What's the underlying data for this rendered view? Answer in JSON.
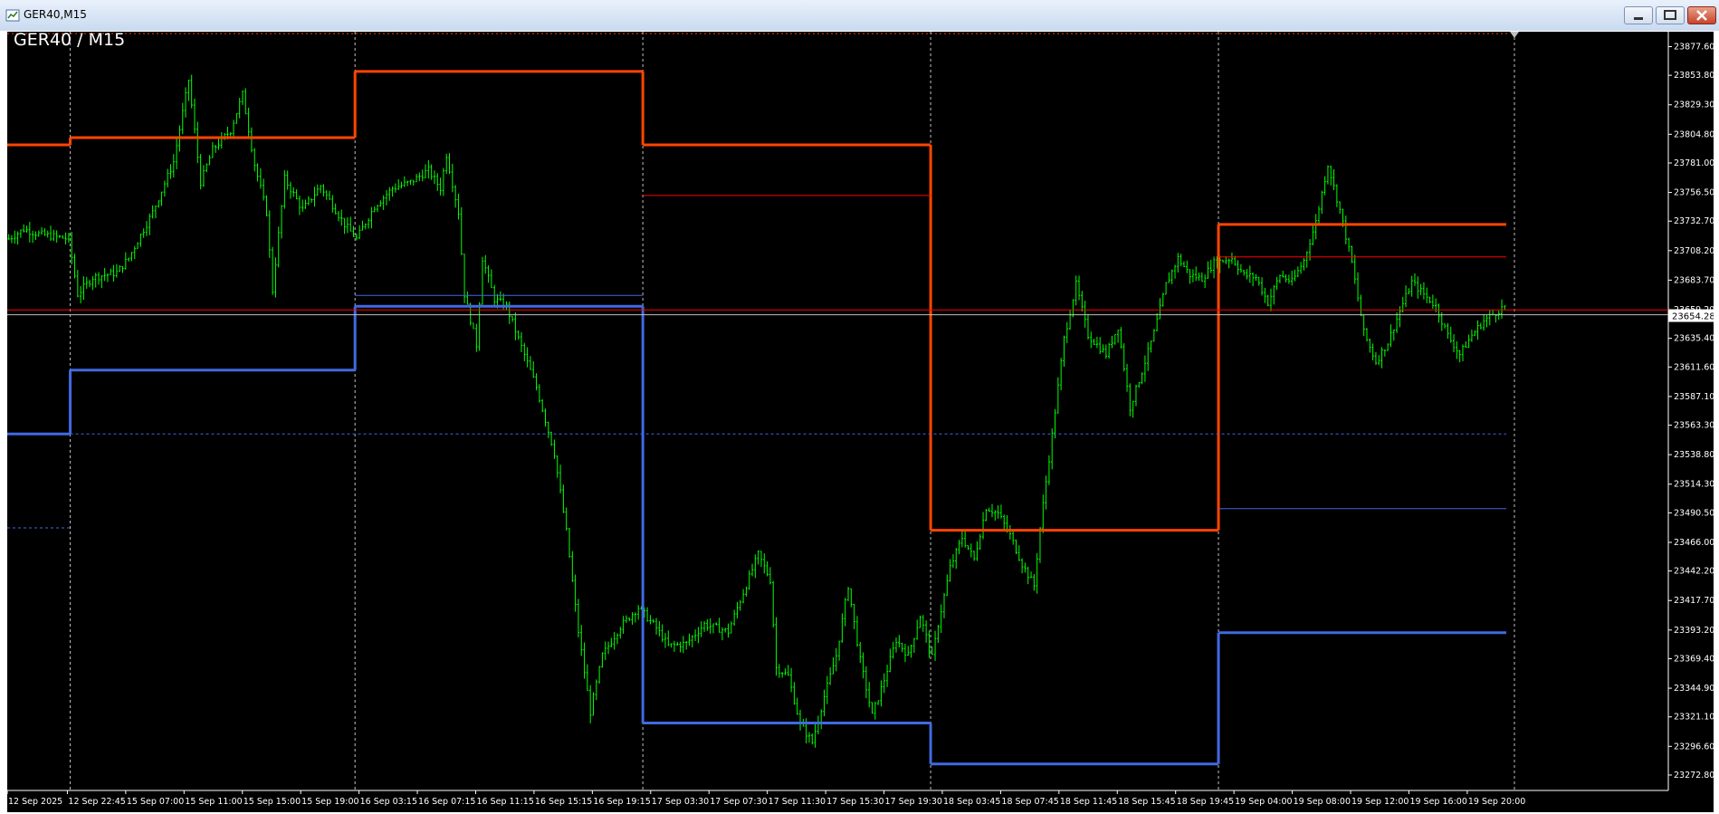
{
  "window": {
    "title": "GER40,M15"
  },
  "chart_label": "GER40 / M15",
  "colors": {
    "background": "#000000",
    "candles": "#00ff00",
    "orange_level": "#ff4500",
    "blue_level": "#4169e1",
    "red_line": "#ff0000",
    "grid_separator": "#c0c0c0",
    "price_tag_bg": "#ffffff"
  },
  "icons": {
    "minimize": "minimize-icon",
    "maximize": "maximize-icon",
    "close": "close-icon"
  },
  "chart_data": {
    "type": "candlestick",
    "symbol": "GER40",
    "timeframe": "M15",
    "current_price": "23654.28",
    "ylim": [
      23260,
      23890
    ],
    "y_ticks": [
      "23877.60",
      "23853.80",
      "23829.30",
      "23804.80",
      "23781.00",
      "23756.50",
      "23732.70",
      "23708.20",
      "23683.70",
      "23659.20",
      "23635.40",
      "23611.60",
      "23587.10",
      "23563.30",
      "23538.80",
      "23514.30",
      "23490.50",
      "23466.00",
      "23442.20",
      "23417.70",
      "23393.20",
      "23369.40",
      "23344.90",
      "23321.10",
      "23296.60",
      "23272.80"
    ],
    "x_ticks": [
      "12 Sep 2025",
      "12 Sep 22:45",
      "15 Sep 07:00",
      "15 Sep 11:00",
      "15 Sep 15:00",
      "15 Sep 19:00",
      "16 Sep 03:15",
      "16 Sep 07:15",
      "16 Sep 11:15",
      "16 Sep 15:15",
      "16 Sep 19:15",
      "17 Sep 03:30",
      "17 Sep 07:30",
      "17 Sep 11:30",
      "17 Sep 15:30",
      "17 Sep 19:30",
      "18 Sep 03:45",
      "18 Sep 07:45",
      "18 Sep 11:45",
      "18 Sep 15:45",
      "18 Sep 19:45",
      "19 Sep 04:00",
      "19 Sep 08:00",
      "19 Sep 12:00",
      "19 Sep 16:00",
      "19 Sep 20:00"
    ],
    "n_bars": 500,
    "day_separators_at_bar": [
      21,
      116,
      212,
      308,
      404
    ],
    "price_path": [
      [
        0,
        23718
      ],
      [
        5,
        23726
      ],
      [
        10,
        23722
      ],
      [
        20,
        23718
      ],
      [
        23,
        23672
      ],
      [
        28,
        23686
      ],
      [
        36,
        23690
      ],
      [
        40,
        23702
      ],
      [
        48,
        23740
      ],
      [
        55,
        23782
      ],
      [
        60,
        23850
      ],
      [
        64,
        23765
      ],
      [
        68,
        23792
      ],
      [
        74,
        23808
      ],
      [
        78,
        23838
      ],
      [
        82,
        23780
      ],
      [
        86,
        23740
      ],
      [
        88,
        23675
      ],
      [
        92,
        23768
      ],
      [
        98,
        23742
      ],
      [
        104,
        23762
      ],
      [
        112,
        23730
      ],
      [
        116,
        23718
      ],
      [
        122,
        23745
      ],
      [
        128,
        23760
      ],
      [
        134,
        23765
      ],
      [
        140,
        23775
      ],
      [
        144,
        23760
      ],
      [
        146,
        23788
      ],
      [
        150,
        23740
      ],
      [
        152,
        23672
      ],
      [
        156,
        23630
      ],
      [
        158,
        23702
      ],
      [
        162,
        23668
      ],
      [
        166,
        23662
      ],
      [
        170,
        23635
      ],
      [
        176,
        23595
      ],
      [
        182,
        23540
      ],
      [
        186,
        23475
      ],
      [
        190,
        23392
      ],
      [
        194,
        23325
      ],
      [
        198,
        23372
      ],
      [
        204,
        23396
      ],
      [
        210,
        23412
      ],
      [
        216,
        23395
      ],
      [
        220,
        23380
      ],
      [
        226,
        23382
      ],
      [
        232,
        23398
      ],
      [
        240,
        23392
      ],
      [
        244,
        23418
      ],
      [
        250,
        23456
      ],
      [
        254,
        23435
      ],
      [
        256,
        23362
      ],
      [
        260,
        23355
      ],
      [
        264,
        23315
      ],
      [
        268,
        23300
      ],
      [
        272,
        23338
      ],
      [
        276,
        23372
      ],
      [
        280,
        23430
      ],
      [
        284,
        23368
      ],
      [
        288,
        23322
      ],
      [
        292,
        23352
      ],
      [
        296,
        23385
      ],
      [
        300,
        23372
      ],
      [
        304,
        23405
      ],
      [
        308,
        23370
      ],
      [
        310,
        23398
      ],
      [
        314,
        23445
      ],
      [
        318,
        23470
      ],
      [
        322,
        23452
      ],
      [
        326,
        23495
      ],
      [
        330,
        23490
      ],
      [
        334,
        23472
      ],
      [
        338,
        23448
      ],
      [
        342,
        23430
      ],
      [
        344,
        23478
      ],
      [
        348,
        23555
      ],
      [
        352,
        23635
      ],
      [
        356,
        23680
      ],
      [
        360,
        23638
      ],
      [
        366,
        23622
      ],
      [
        370,
        23645
      ],
      [
        374,
        23578
      ],
      [
        378,
        23608
      ],
      [
        382,
        23640
      ],
      [
        386,
        23680
      ],
      [
        390,
        23702
      ],
      [
        394,
        23688
      ],
      [
        398,
        23685
      ],
      [
        402,
        23698
      ],
      [
        408,
        23702
      ],
      [
        412,
        23688
      ],
      [
        416,
        23686
      ],
      [
        420,
        23665
      ],
      [
        424,
        23688
      ],
      [
        428,
        23682
      ],
      [
        432,
        23700
      ],
      [
        436,
        23732
      ],
      [
        440,
        23780
      ],
      [
        444,
        23742
      ],
      [
        448,
        23698
      ],
      [
        452,
        23640
      ],
      [
        456,
        23616
      ],
      [
        460,
        23632
      ],
      [
        464,
        23658
      ],
      [
        468,
        23682
      ],
      [
        472,
        23672
      ],
      [
        476,
        23662
      ],
      [
        480,
        23638
      ],
      [
        484,
        23622
      ],
      [
        488,
        23638
      ],
      [
        492,
        23650
      ],
      [
        499,
        23662
      ]
    ],
    "levels": [
      {
        "name": "orange-level",
        "color": "#ff4500",
        "width": 3,
        "style": "solid",
        "steps": [
          [
            0,
            23796
          ],
          [
            21,
            23802
          ],
          [
            116,
            23857
          ],
          [
            212,
            23796
          ],
          [
            308,
            23476
          ],
          [
            404,
            23730
          ]
        ],
        "end_bar": 500
      },
      {
        "name": "blue-level",
        "color": "#4169e1",
        "width": 3,
        "style": "solid",
        "steps": [
          [
            0,
            23556
          ],
          [
            21,
            23609
          ],
          [
            116,
            23662
          ],
          [
            212,
            23316
          ],
          [
            308,
            23282
          ],
          [
            404,
            23391
          ]
        ],
        "end_bar": 500
      },
      {
        "name": "blue-upper",
        "color": "#4169e1",
        "width": 1,
        "style": "solid",
        "steps": [
          [
            116,
            23671
          ],
          [
            212,
            null
          ],
          [
            404,
            23494
          ]
        ],
        "end_bar": 500
      },
      {
        "name": "blue-mid-dotted",
        "color": "#4169e1",
        "width": 1,
        "style": "dotted",
        "steps": [
          [
            0,
            23478
          ],
          [
            21,
            23556
          ]
        ],
        "end_bar": 500
      },
      {
        "name": "red-level",
        "color": "#ff0000",
        "width": 1,
        "style": "solid",
        "steps": [
          [
            212,
            23754
          ],
          [
            308,
            null
          ],
          [
            404,
            23703
          ]
        ],
        "end_bar": 500
      }
    ],
    "horizontal_lines": [
      {
        "name": "current-price-line",
        "value": 23659,
        "color": "#ff0000",
        "style": "solid"
      },
      {
        "name": "bid-line",
        "value": 23655,
        "color": "#c0c0c0",
        "style": "solid"
      }
    ]
  }
}
